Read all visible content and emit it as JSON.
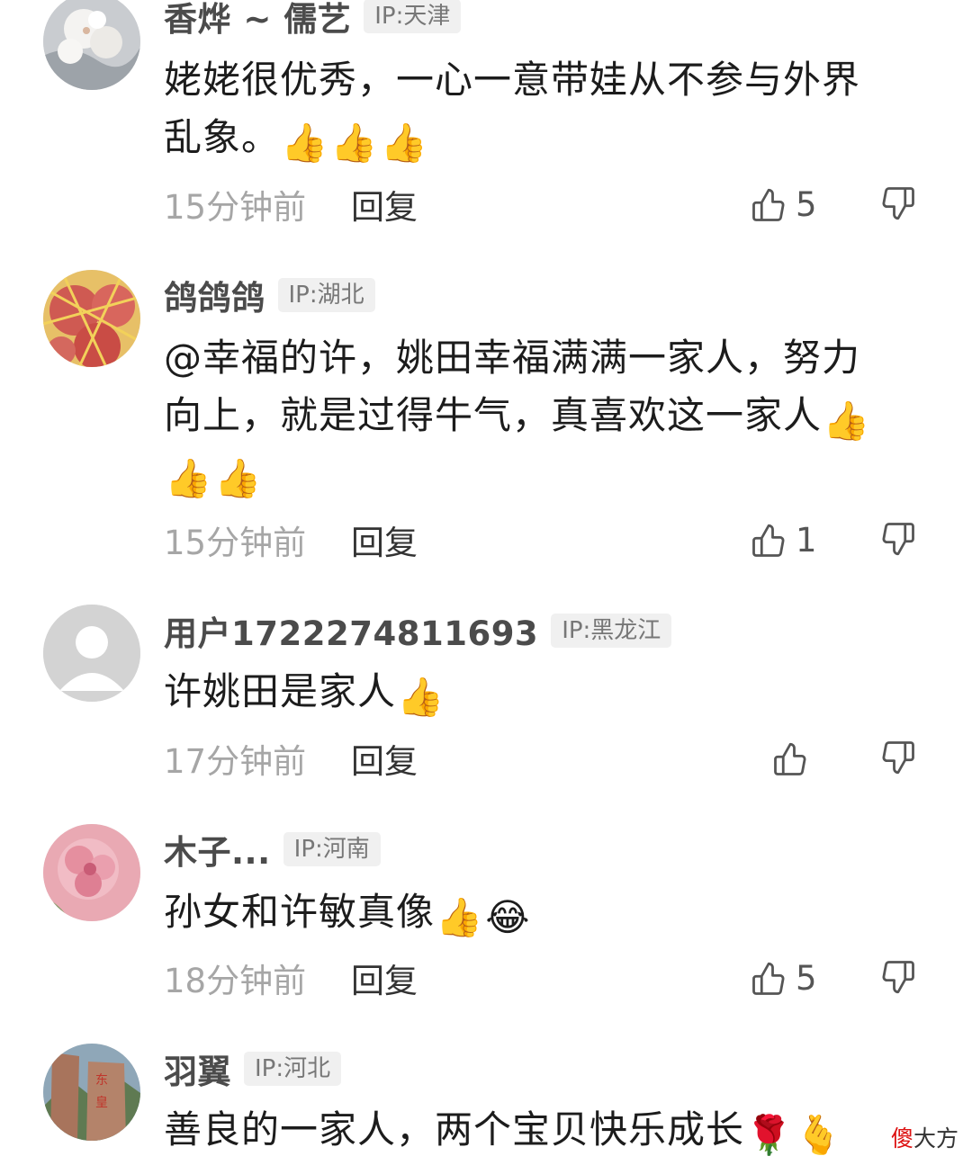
{
  "comments": [
    {
      "username": "香烨 ~ 儒艺",
      "ip": "IP:天津",
      "text_lines": [
        "姥姥很优秀，一心一意带娃从不参与外界",
        "乱象。"
      ],
      "time": "15分钟前",
      "reply": "回复",
      "likes": "5",
      "avatar": "white-blossom-avatar",
      "emoji": "thumbs-up"
    },
    {
      "username": "鸽鸽鸽",
      "ip": "IP:湖北",
      "text_lines": [
        "@幸福的许，姚田幸福满满一家人，努力",
        "向上，就是过得牛气，真喜欢这一家人",
        ""
      ],
      "time": "15分钟前",
      "reply": "回复",
      "likes": "1",
      "avatar": "apples-avatar",
      "emoji": "thumbs-up"
    },
    {
      "username": "用户1722274811693",
      "ip": "IP:黑龙江",
      "text_lines": [
        "许姚田是家人"
      ],
      "time": "17分钟前",
      "reply": "回复",
      "likes": "",
      "avatar": "default-user-avatar",
      "emoji": "thumbs-up"
    },
    {
      "username": "木子...",
      "ip": "IP:河南",
      "text_lines": [
        "孙女和许敏真像"
      ],
      "time": "18分钟前",
      "reply": "回复",
      "likes": "5",
      "avatar": "pink-flower-avatar",
      "emoji": "thumbs-up, tears-of-joy"
    },
    {
      "username": "羽翼",
      "ip": "IP:河北",
      "text_lines": [
        "善良的一家人，两个宝贝快乐成长"
      ],
      "avatar": "mountain-stone-avatar",
      "emoji": "rose, finger-heart"
    }
  ],
  "watermark": {
    "part1": "傻",
    "part2": "大方"
  },
  "colors": {
    "username": "#4b4b4b",
    "ip_bg": "#f0f0f0",
    "time": "#a6a6a6",
    "text": "#1c1c1c"
  }
}
